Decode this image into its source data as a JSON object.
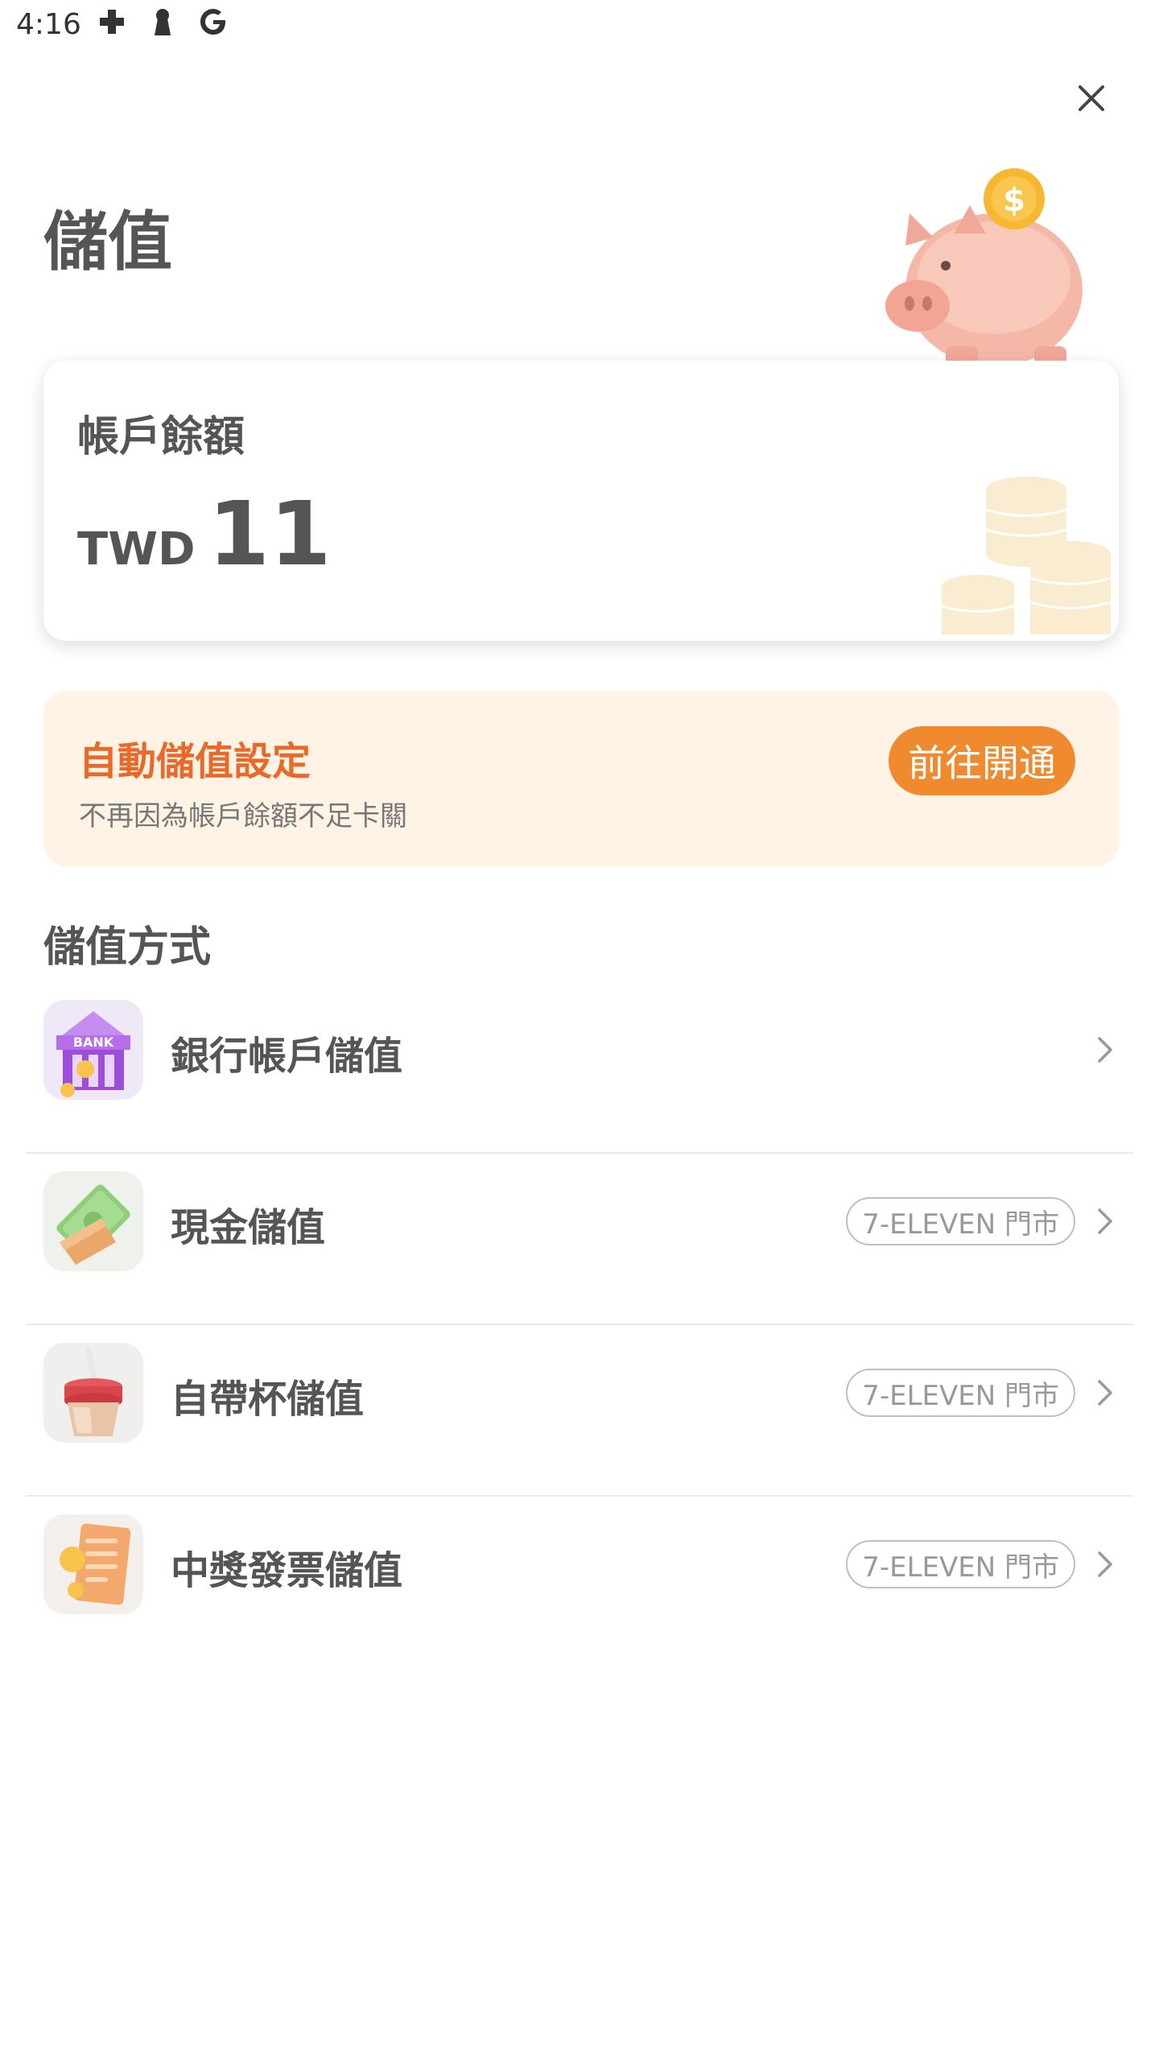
{
  "status_bar": {
    "time": "4:16"
  },
  "header": {
    "title": "儲值"
  },
  "balance": {
    "label": "帳戶餘額",
    "currency": "TWD",
    "amount": "11"
  },
  "auto_topup": {
    "title": "自動儲值設定",
    "subtitle": "不再因為帳戶餘額不足卡關",
    "button": "前往開通"
  },
  "methods_section": {
    "title": "儲值方式",
    "items": [
      {
        "label": "銀行帳戶儲值",
        "badge": "",
        "icon": "bank-icon"
      },
      {
        "label": "現金儲值",
        "badge": "7-ELEVEN 門市",
        "icon": "cash-icon"
      },
      {
        "label": "自帶杯儲值",
        "badge": "7-ELEVEN 門市",
        "icon": "cup-icon"
      },
      {
        "label": "中獎發票儲值",
        "badge": "7-ELEVEN 門市",
        "icon": "receipt-icon"
      }
    ]
  },
  "colors": {
    "accent": "#f08a2e",
    "accent_text": "#e8692a",
    "banner_bg": "#fff3e6"
  }
}
